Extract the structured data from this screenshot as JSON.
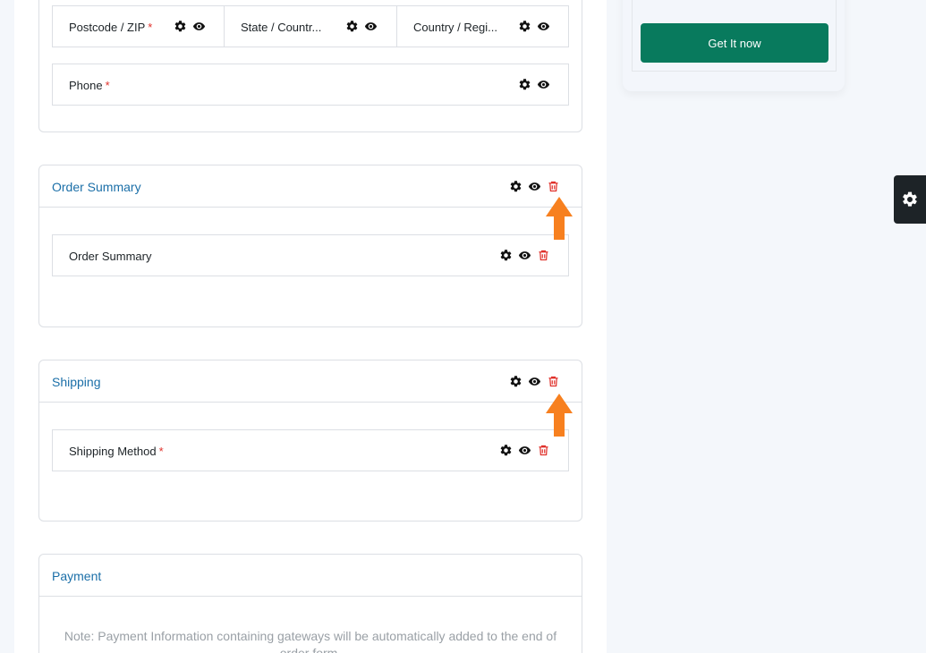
{
  "address_section": {
    "fields": [
      {
        "label": "Postcode / ZIP",
        "required": true
      },
      {
        "label": "State / Countr...",
        "required": false
      },
      {
        "label": "Country / Regi...",
        "required": false
      }
    ],
    "phone": {
      "label": "Phone",
      "required": true
    }
  },
  "order_summary": {
    "title": "Order Summary",
    "field": {
      "label": "Order Summary"
    }
  },
  "shipping": {
    "title": "Shipping",
    "field": {
      "label": "Shipping Method",
      "required": true
    }
  },
  "payment": {
    "title": "Payment",
    "note": "Note: Payment Information containing gateways will be automatically added to the end of order form."
  },
  "promo": {
    "button_label": "Get It now"
  },
  "required_mark": "*",
  "icons": [
    "gear-icon",
    "eye-icon",
    "trash-icon",
    "arrow-up-icon"
  ],
  "colors": {
    "accent": "#1b6fa8",
    "cta": "#087a5d",
    "danger": "#e0312b",
    "arrow": "#f7801f",
    "dark": "#1d2327"
  }
}
